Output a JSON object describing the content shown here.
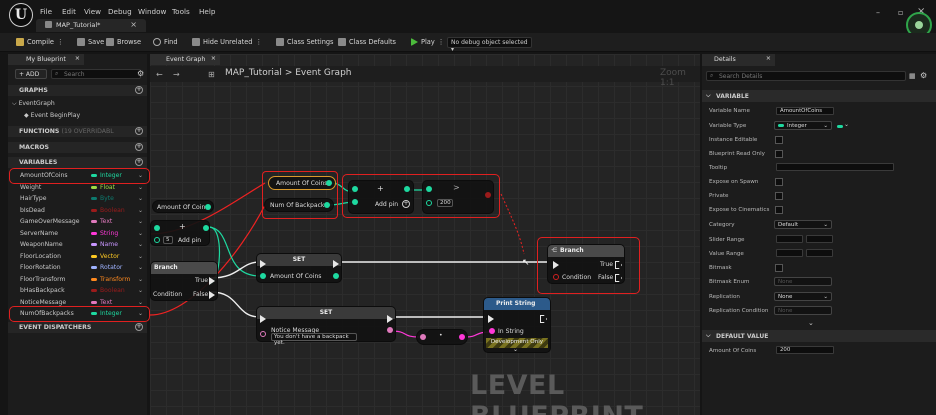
{
  "menubar": {
    "items": [
      "File",
      "Edit",
      "View",
      "Debug",
      "Window",
      "Tools",
      "Help"
    ]
  },
  "document_tab": {
    "title": "MAP_Tutorial*"
  },
  "toolbar": {
    "compile": "Compile",
    "save": "Save",
    "browse": "Browse",
    "find": "Find",
    "hide_unrelated": "Hide Unrelated",
    "class_settings": "Class Settings",
    "class_defaults": "Class Defaults",
    "play": "Play",
    "debug_object": "No debug object selected"
  },
  "my_blueprint": {
    "tab_title": "My Blueprint",
    "add_label": "+ ADD",
    "search_placeholder": "Search",
    "graphs_header": "GRAPHS",
    "event_graph": "EventGraph",
    "event_begin_play": "Event BeginPlay",
    "functions_header": "FUNCTIONS",
    "functions_note": "(19 OVERRIDABL",
    "macros_header": "MACROS",
    "variables_header": "VARIABLES",
    "event_dispatchers_header": "EVENT DISPATCHERS",
    "variables": [
      {
        "name": "AmountOfCoins",
        "type": "Integer",
        "color": "#1ed9a0"
      },
      {
        "name": "Weight",
        "type": "Float",
        "color": "#9edb45"
      },
      {
        "name": "HairType",
        "type": "Byte",
        "color": "#0d7a6e"
      },
      {
        "name": "bIsDead",
        "type": "Boolean",
        "color": "#9b1b1b"
      },
      {
        "name": "GameOverMessage",
        "type": "Text",
        "color": "#e07abd"
      },
      {
        "name": "ServerName",
        "type": "String",
        "color": "#ff38d8"
      },
      {
        "name": "WeaponName",
        "type": "Name",
        "color": "#c896ff"
      },
      {
        "name": "FloorLocation",
        "type": "Vector",
        "color": "#ffca23"
      },
      {
        "name": "FloorRotation",
        "type": "Rotator",
        "color": "#9fb3ff"
      },
      {
        "name": "FloorTransform",
        "type": "Transform",
        "color": "#ff8a1f"
      },
      {
        "name": "bHasBackpack",
        "type": "Boolean",
        "color": "#9b1b1b"
      },
      {
        "name": "NoticeMessage",
        "type": "Text",
        "color": "#e07abd"
      },
      {
        "name": "NumOfBackpacks",
        "type": "Integer",
        "color": "#1ed9a0"
      }
    ]
  },
  "graph": {
    "tab_title": "Event Graph",
    "breadcrumb_root": "MAP_Tutorial",
    "breadcrumb_sep": ">",
    "breadcrumb_leaf": "Event Graph",
    "zoom": "Zoom 1:1",
    "watermark": "LEVEL BLUEPRINT",
    "nodes": {
      "amount_of_coins_left": "Amount Of Coins",
      "amount_of_coins_top": "Amount Of Coins",
      "num_of_backpacks": "Num Of Backpacks",
      "add_pin": "Add pin",
      "add_pin_left": "Add pin",
      "add_left_value": "5",
      "compare_value": "200",
      "branch_title": "Branch",
      "branch_condition": "Condition",
      "branch_true": "True",
      "branch_false": "False",
      "branch_left_title": "Branch",
      "branch_left_true": "True",
      "branch_left_false": "False",
      "branch_left_condition": "Condition",
      "set1_title": "SET",
      "set1_pin": "Amount Of Coins",
      "set2_title": "SET",
      "set2_pin": "Notice Message",
      "set2_value": "You don't have a backpack yet.",
      "print_title": "Print String",
      "print_in": "In String",
      "print_dev": "Development Only"
    }
  },
  "details": {
    "tab_title": "Details",
    "search_placeholder": "Search Details",
    "variable_header": "VARIABLE",
    "default_header": "DEFAULT VALUE",
    "labels": {
      "variable_name": "Variable Name",
      "variable_type": "Variable Type",
      "instance_editable": "Instance Editable",
      "blueprint_read_only": "Blueprint Read Only",
      "tooltip": "Tooltip",
      "expose_on_spawn": "Expose on Spawn",
      "private": "Private",
      "expose_to_cinematics": "Expose to Cinematics",
      "category": "Category",
      "slider_range": "Slider Range",
      "value_range": "Value Range",
      "bitmask": "Bitmask",
      "bitmask_enum": "Bitmask Enum",
      "replication": "Replication",
      "replication_condition": "Replication Condition",
      "amount_of_coins": "Amount Of Coins"
    },
    "values": {
      "variable_name": "AmountOfCoins",
      "variable_type": "Integer",
      "category": "Default",
      "bitmask_enum": "None",
      "replication": "None",
      "replication_condition": "None",
      "amount_of_coins": "200"
    },
    "colors": {
      "integer": "#1ed9a0"
    }
  }
}
